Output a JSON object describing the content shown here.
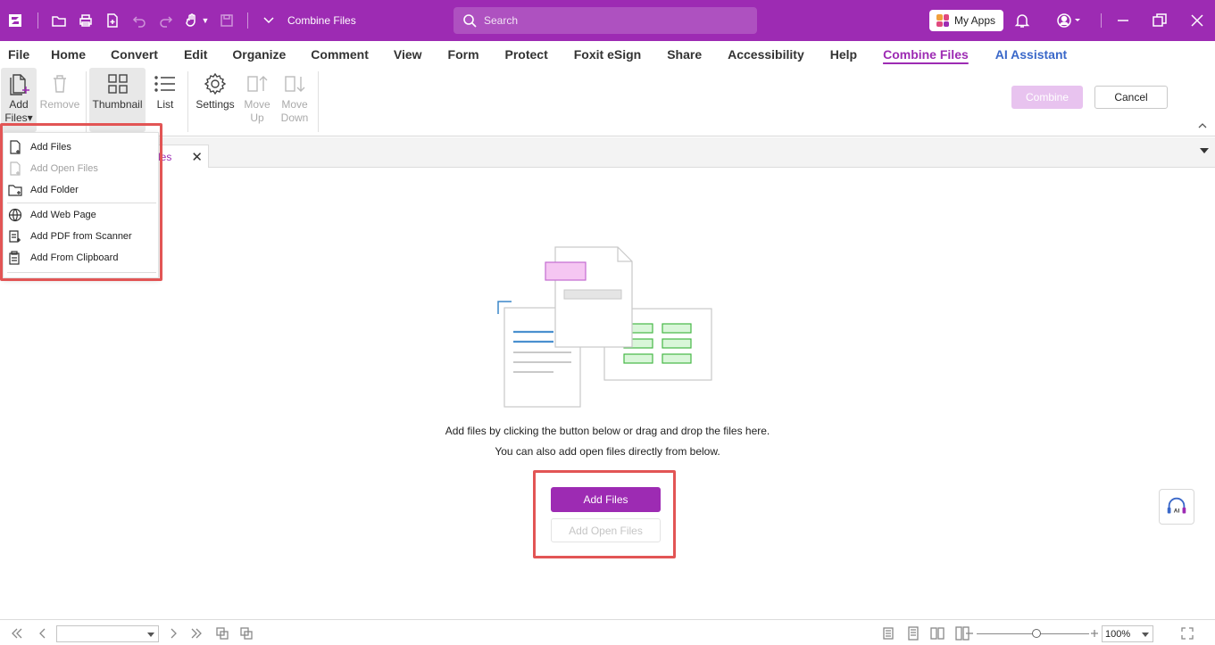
{
  "window": {
    "title": "Combine Files"
  },
  "search": {
    "placeholder": "Search"
  },
  "top_right": {
    "my_apps_label": "My Apps"
  },
  "colors": {
    "brand": "#9d2bb3",
    "highlight": "#e25555",
    "disabled_combine": "#e8c3ef",
    "ai_assistant": "#3a68c9"
  },
  "menu": [
    "File",
    "Home",
    "Convert",
    "Edit",
    "Organize",
    "Comment",
    "View",
    "Form",
    "Protect",
    "Foxit eSign",
    "Share",
    "Accessibility",
    "Help",
    "Combine Files",
    "AI Assistant"
  ],
  "ribbon": {
    "add_files_line1": "Add",
    "add_files_line2": "Files",
    "remove": "Remove",
    "thumbnail": "Thumbnail",
    "list": "List",
    "settings": "Settings",
    "move_up_line1": "Move",
    "move_up_line2": "Up",
    "move_down_line1": "Move",
    "move_down_line2": "Down",
    "combine": "Combine",
    "cancel": "Cancel"
  },
  "tab": {
    "label": "les"
  },
  "dropdown": {
    "items": [
      {
        "label": "Add Files",
        "icon": "add-files-icon",
        "disabled": false
      },
      {
        "label": "Add Open Files",
        "icon": "add-open-files-icon",
        "disabled": true
      },
      {
        "label": "Add Folder",
        "icon": "add-folder-icon",
        "disabled": false
      },
      {
        "label": "Add Web Page",
        "icon": "globe-icon",
        "disabled": false
      },
      {
        "label": "Add PDF from Scanner",
        "icon": "scanner-icon",
        "disabled": false
      },
      {
        "label": "Add From Clipboard",
        "icon": "clipboard-icon",
        "disabled": false
      }
    ]
  },
  "empty_state": {
    "line1": "Add files by clicking the button below or drag and drop the files here.",
    "line2": "You can also add open files directly from below.",
    "add_files_button": "Add Files",
    "add_open_files_button": "Add Open Files"
  },
  "ai_float": {
    "label": "AI"
  },
  "statusbar": {
    "zoom": "100%"
  }
}
